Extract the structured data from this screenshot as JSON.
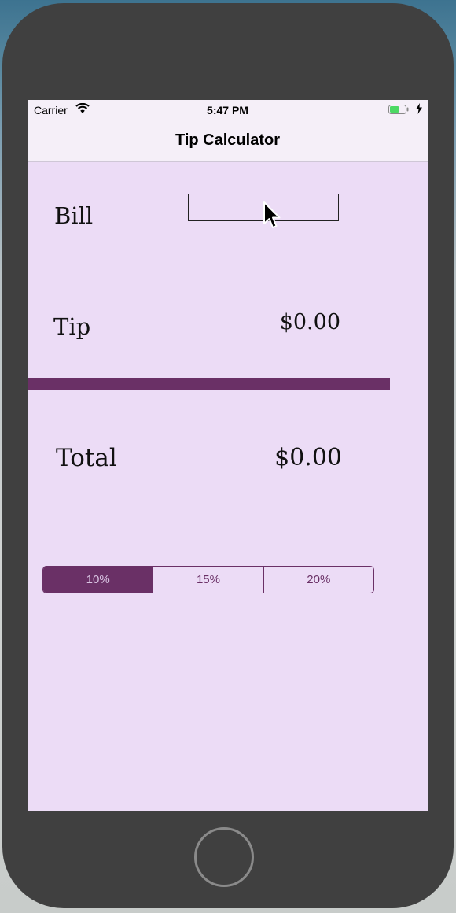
{
  "status_bar": {
    "carrier": "Carrier",
    "time": "5:47 PM",
    "wifi_icon": "wifi-icon",
    "battery_icon": "battery-icon",
    "charging_icon": "charging-bolt-icon",
    "battery_level": 0.6
  },
  "nav": {
    "title": "Tip Calculator"
  },
  "bill": {
    "label": "Bill",
    "value": "",
    "placeholder": ""
  },
  "tip": {
    "label": "Tip",
    "value": "$0.00"
  },
  "total": {
    "label": "Total",
    "value": "$0.00"
  },
  "tip_options": {
    "segments": [
      "10%",
      "15%",
      "20%"
    ],
    "selected_index": 0
  },
  "colors": {
    "background": "#ecdcf6",
    "accent": "#6a3066",
    "bar_background": "#f5eff8",
    "device_frame": "#404040",
    "battery_fill": "#4cd964"
  },
  "icons": {
    "cursor": "mouse-pointer-icon",
    "home": "home-button-icon"
  }
}
